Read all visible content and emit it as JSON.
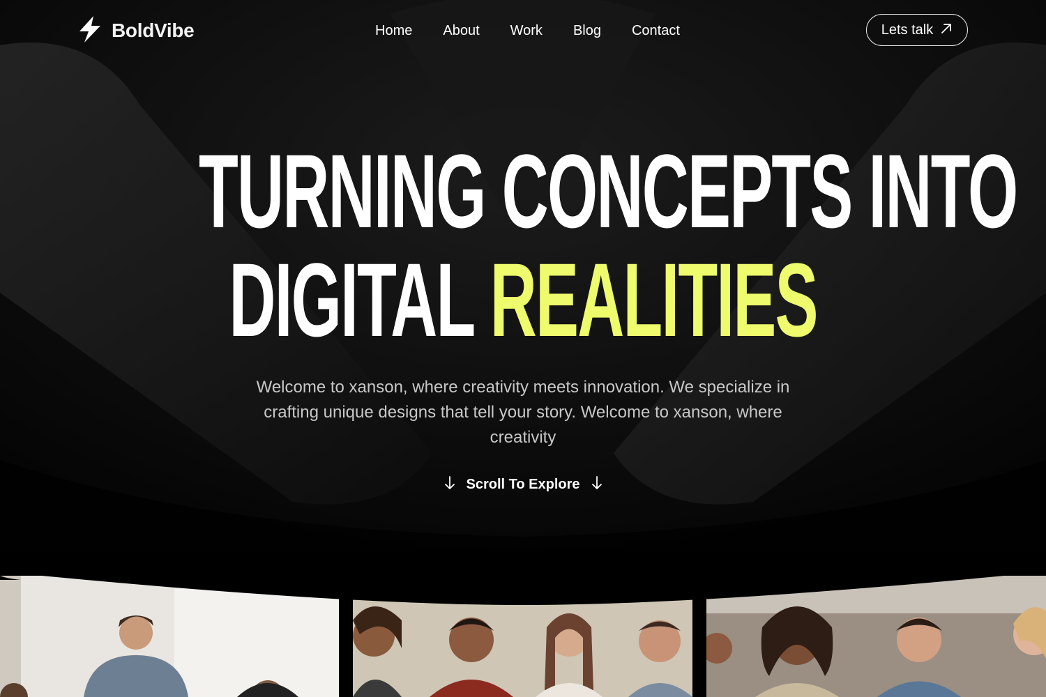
{
  "brand": {
    "name": "BoldVibe",
    "icon": "lightning-bolt-icon"
  },
  "nav": {
    "items": [
      {
        "label": "Home"
      },
      {
        "label": "About"
      },
      {
        "label": "Work"
      },
      {
        "label": "Blog"
      },
      {
        "label": "Contact"
      }
    ]
  },
  "cta": {
    "label": "Lets talk",
    "icon": "arrow-up-right-icon"
  },
  "hero": {
    "line1": "TURNING CONCEPTS INTO",
    "line2_plain": "DIGITAL",
    "line2_accent": "REALITIES",
    "intro": "Welcome to xanson, where creativity meets innovation. We specialize in crafting unique designs that tell your story. Welcome to xanson, where creativity",
    "scroll_label": "Scroll To Explore",
    "scroll_icon": "arrow-down-icon"
  },
  "colors": {
    "background": "#000000",
    "accent": "#eefb6c",
    "text": "#ffffff",
    "muted_text": "#c8c8c8"
  }
}
